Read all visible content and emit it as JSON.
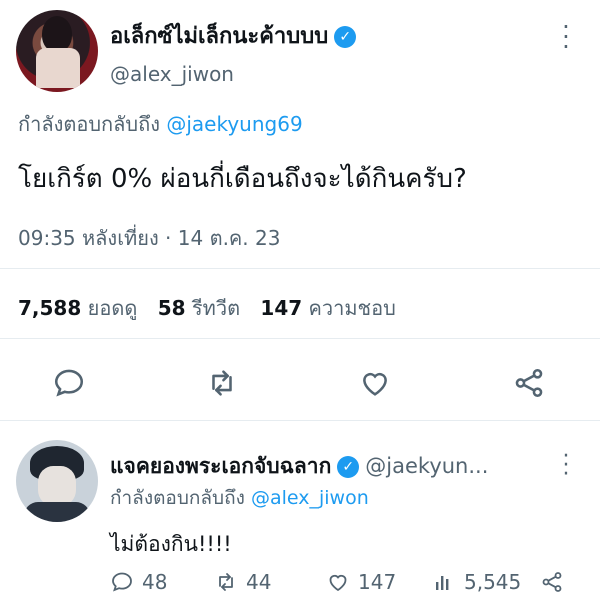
{
  "tweet": {
    "display_name": "อเล็กซ์ไม่เล็กนะค้าบบบ",
    "handle": "@alex_jiwon",
    "replying_label": "กำลังตอบกลับถึง",
    "replying_to": "@jaekyung69",
    "text": "โยเกิร์ต 0% ผ่อนกี่เดือนถึงจะได้กินครับ?",
    "timestamp": "09:35 หลังเที่ยง · 14 ต.ค. 23",
    "stats": {
      "views_count": "7,588",
      "views_label": "ยอดดู",
      "retweets_count": "58",
      "retweets_label": "รีทวีต",
      "likes_count": "147",
      "likes_label": "ความชอบ"
    },
    "actions": [
      "reply-icon",
      "retweet-icon",
      "like-icon",
      "share-icon"
    ]
  },
  "reply": {
    "display_name": "แจคยองพระเอกจับฉลาก",
    "handle": "@jaekyun...",
    "replying_label": "กำลังตอบกลับถึง",
    "replying_to": "@alex_jiwon",
    "text": "ไม่ต้องกิน!!!!",
    "replies": "48",
    "retweets": "44",
    "likes": "147",
    "views": "5,545"
  },
  "colors": {
    "accent": "#1d9bf0",
    "secondary_text": "#536471",
    "primary_text": "#0f1419"
  }
}
